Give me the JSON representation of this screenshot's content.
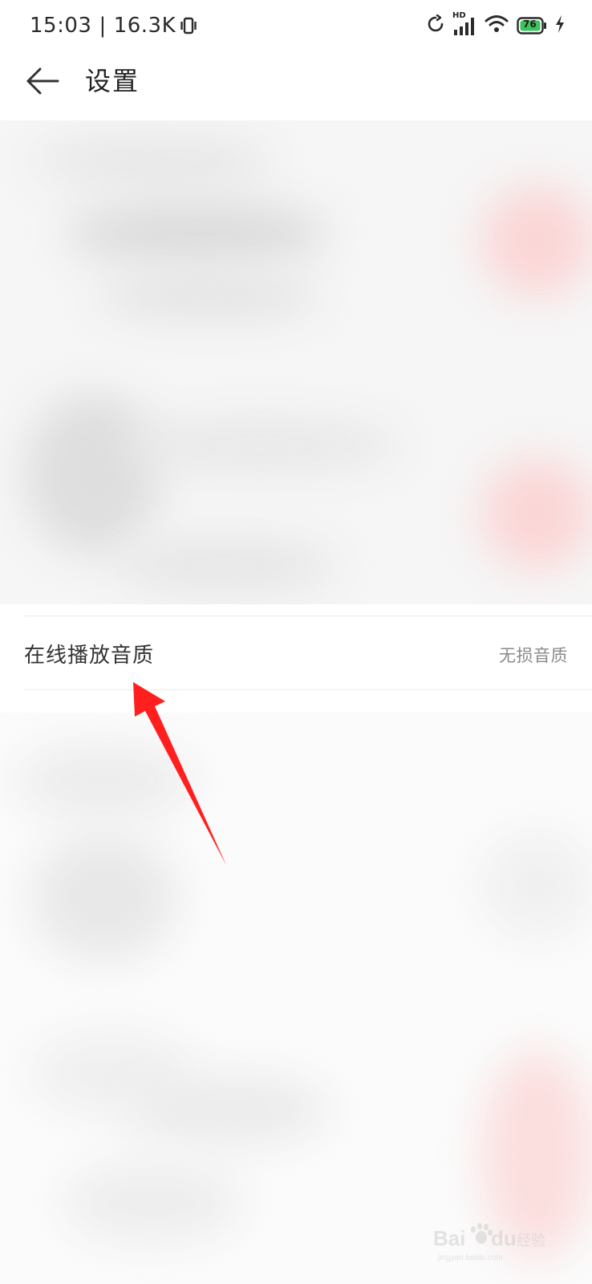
{
  "status_bar": {
    "time": "15:03",
    "separator": "|",
    "net_speed": "16.3K",
    "hd_label": "HD",
    "battery_level": "76",
    "icons": [
      "vibrate-icon",
      "sync-icon",
      "signal-icon",
      "wifi-icon",
      "battery-icon",
      "charging-icon"
    ]
  },
  "header": {
    "back_icon": "back-arrow-icon",
    "title": "设置"
  },
  "settings": {
    "rows": [
      {
        "label": "在线播放音质",
        "value": "无损音质"
      }
    ]
  },
  "annotation": {
    "type": "arrow",
    "color": "#ff2020",
    "target": "online-playback-quality-row"
  },
  "colors": {
    "battery_fill": "#3ac45a",
    "annotation_red": "#ff1f1f",
    "blur_accent": "#fbdede"
  }
}
